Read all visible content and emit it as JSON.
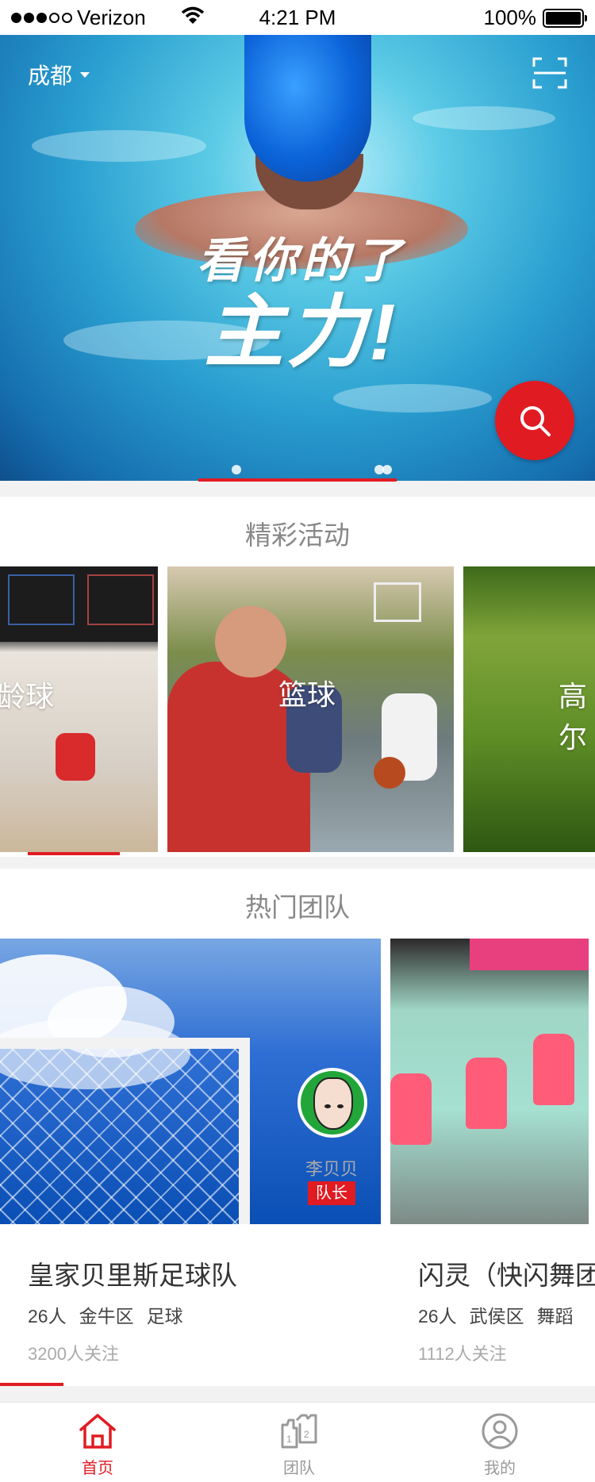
{
  "status_bar": {
    "carrier": "Verizon",
    "time": "4:21 PM",
    "battery": "100%"
  },
  "hero": {
    "city": "成都",
    "slogan_line1": "看你的了",
    "slogan_line2": "主力!",
    "carousel_page_count": 3,
    "carousel_active_index": 1
  },
  "activities": {
    "title": "精彩活动",
    "items": [
      {
        "label": "保龄球",
        "visible_label": "龄球"
      },
      {
        "label": "篮球"
      },
      {
        "label": "高尔夫",
        "visible_label": "高尔"
      }
    ]
  },
  "teams": {
    "title": "热门团队",
    "items": [
      {
        "name": "皇家贝里斯足球队",
        "members": "26人",
        "district": "金牛区",
        "sport": "足球",
        "followers": "3200人关注",
        "captain_name": "李贝贝",
        "captain_badge": "队长"
      },
      {
        "name": "闪灵（快闪舞团",
        "members": "26人",
        "district": "武侯区",
        "sport": "舞蹈",
        "followers": "1112人关注"
      }
    ]
  },
  "tabbar": {
    "items": [
      {
        "label": "首页",
        "active": true
      },
      {
        "label": "团队",
        "active": false
      },
      {
        "label": "我的",
        "active": false
      }
    ],
    "active_color": "#e11b22",
    "inactive_color": "#9a9a9a"
  },
  "colors": {
    "accent": "#e11b22"
  }
}
